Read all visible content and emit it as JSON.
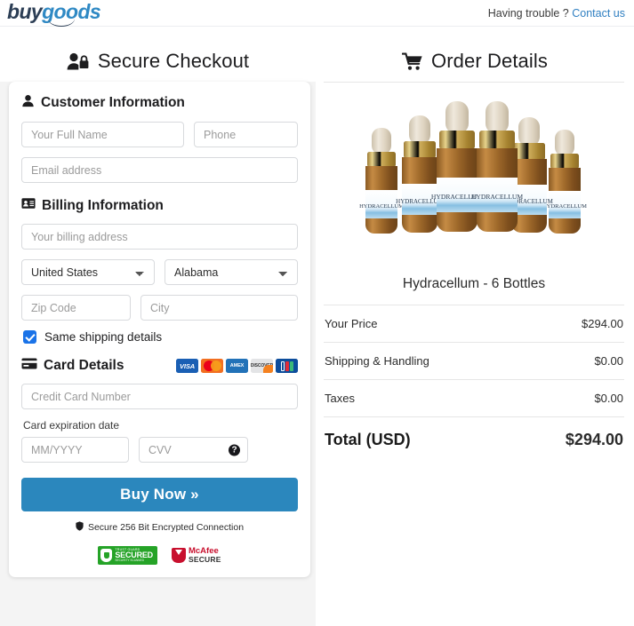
{
  "header": {
    "logo_buy": "buy",
    "logo_goods": "goods",
    "help_label": "Having trouble ?",
    "contact_label": "Contact us"
  },
  "checkout": {
    "title": "Secure Checkout",
    "title_icon": "user-lock-icon",
    "customer": {
      "title": "Customer Information",
      "icon": "user-icon",
      "full_name_placeholder": "Your Full Name",
      "phone_placeholder": "Phone",
      "email_placeholder": "Email address"
    },
    "billing": {
      "title": "Billing Information",
      "icon": "id-card-icon",
      "address_placeholder": "Your billing address",
      "country_value": "United States",
      "country_options": [
        "United States"
      ],
      "state_value": "Alabama",
      "state_options": [
        "Alabama"
      ],
      "zip_placeholder": "Zip Code",
      "city_placeholder": "City",
      "same_shipping_label": "Same shipping details",
      "same_shipping_checked": true
    },
    "card": {
      "title": "Card Details",
      "icon": "credit-card-icon",
      "brands": [
        "VISA",
        "Mastercard",
        "AMEX",
        "DISCOVER",
        "JCB"
      ],
      "number_placeholder": "Credit Card Number",
      "expiration_label": "Card expiration date",
      "expiration_placeholder": "MM/YYYY",
      "cvv_placeholder": "CVV",
      "cvv_help_glyph": "?"
    },
    "buy_button_label": "Buy Now »",
    "secure_note": "Secure 256 Bit Encrypted Connection",
    "secure_note_icon": "shield-icon",
    "trust_badge": {
      "top": "TRUST GUARD",
      "main": "SECURED",
      "bottom": "SECURITY SCANNED"
    },
    "mcafee_badge": {
      "line1": "McAfee",
      "line2": "SECURE"
    }
  },
  "order": {
    "title": "Order Details",
    "title_icon": "shopping-cart-icon",
    "product_name": "Hydracellum - 6 Bottles",
    "product_image_alt": "six-amber-dropper-bottles",
    "bottle_label_text": "HYDRACELLUM",
    "lines": [
      {
        "label": "Your Price",
        "value": "$294.00"
      },
      {
        "label": "Shipping & Handling",
        "value": "$0.00"
      },
      {
        "label": "Taxes",
        "value": "$0.00"
      }
    ],
    "total_label": "Total (USD)",
    "total_value": "$294.00"
  },
  "colors": {
    "accent_blue": "#2b87bd",
    "link_blue": "#2f7fc1",
    "checkbox_blue": "#1a73e8",
    "page_bg": "#f4f4f4"
  }
}
